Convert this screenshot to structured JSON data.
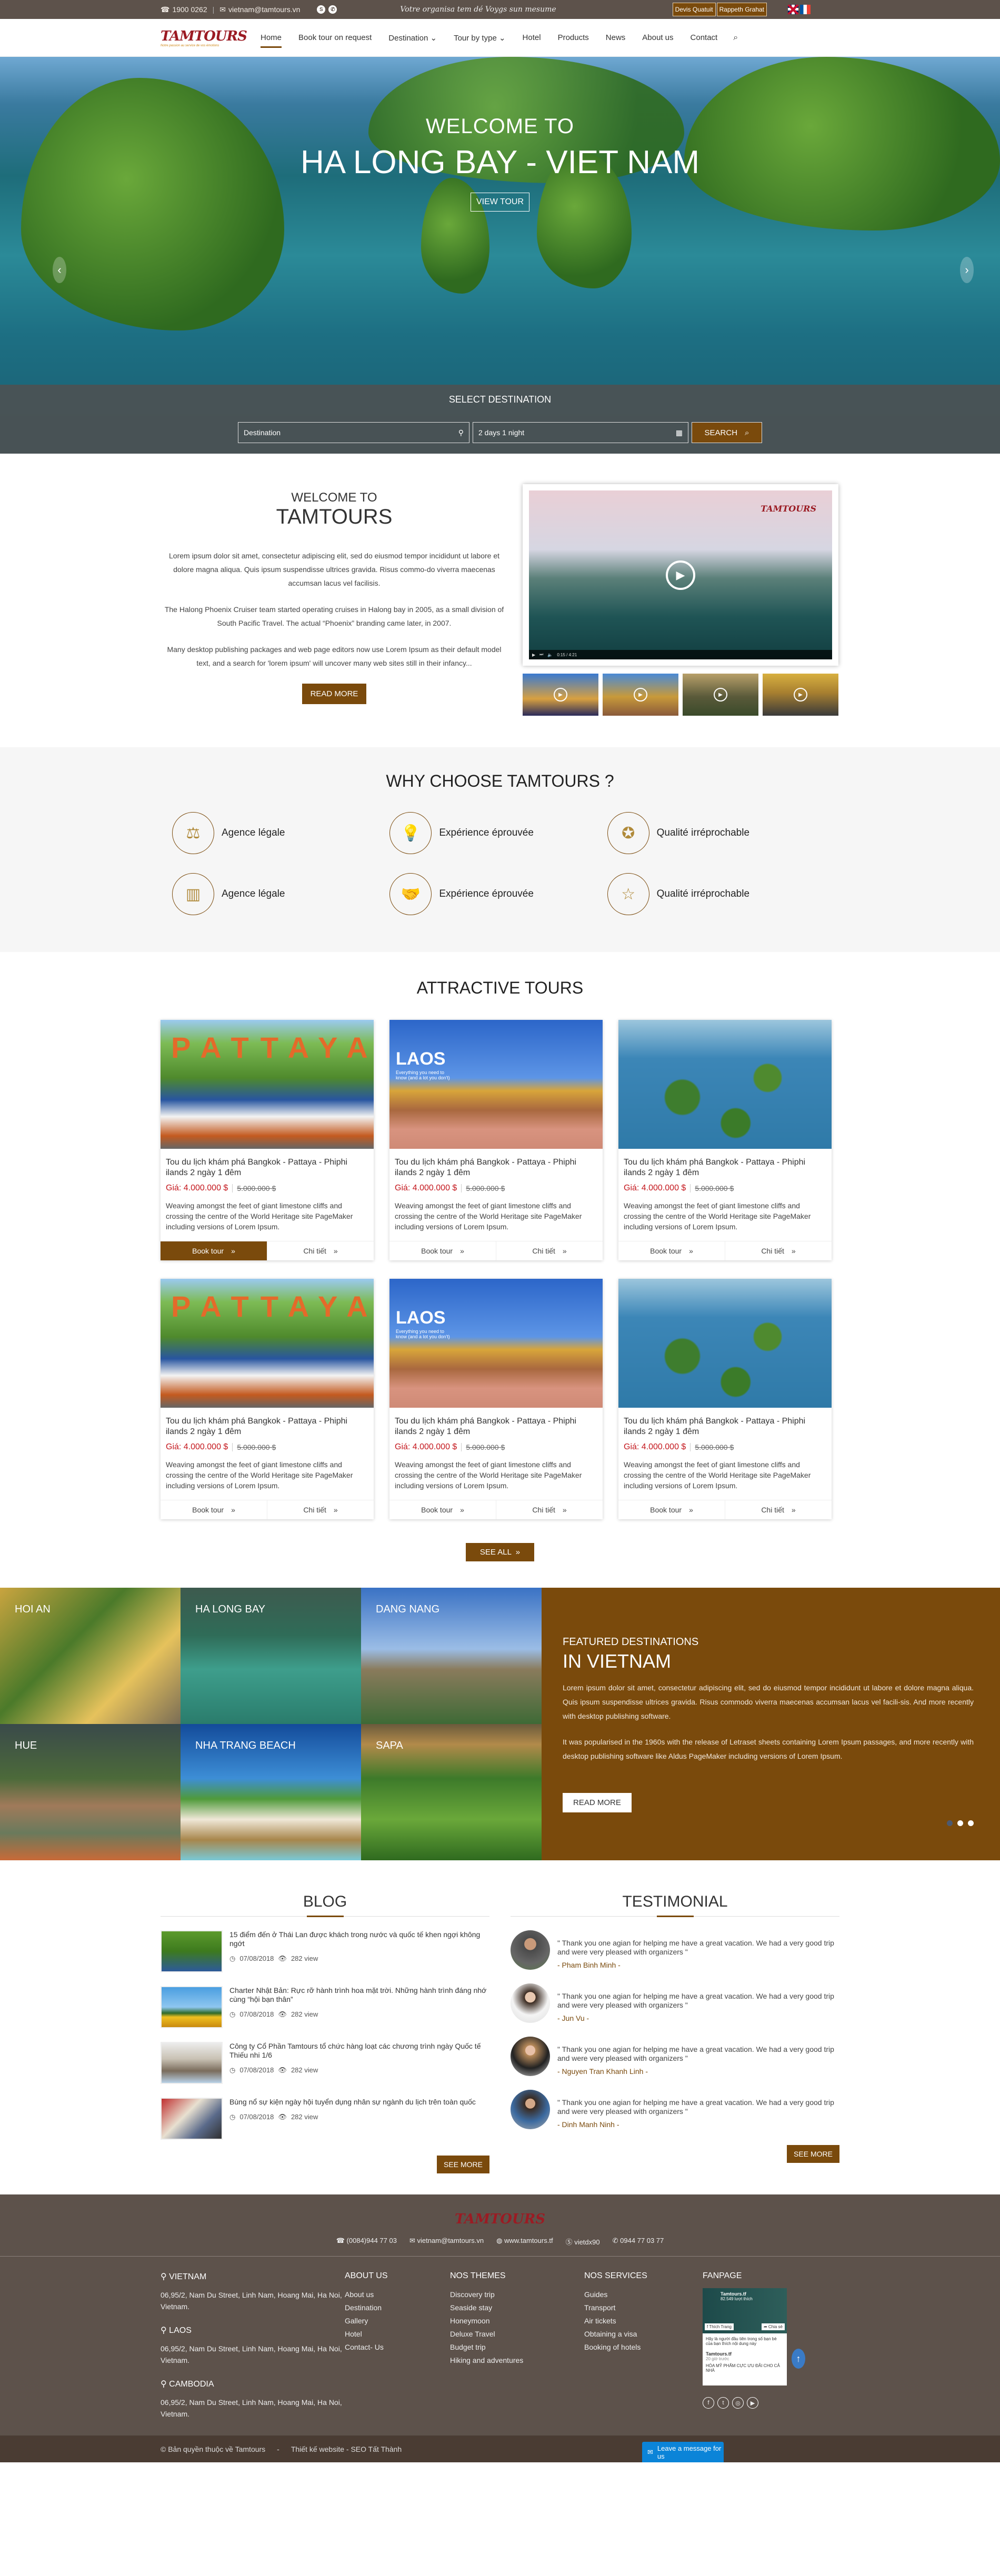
{
  "topbar": {
    "phone": "1900 0262",
    "email": "vietnam@tamtours.vn",
    "slogan": "Votre organisa tem dé Voygs sun mesume",
    "buttons": [
      "Devis Quatuit",
      "Rappeth Grahat"
    ],
    "languages": [
      "English",
      "Français"
    ]
  },
  "nav": {
    "logo_text": "TAMTOURS",
    "logo_tagline": "Notre passion au service de vos émotions",
    "items": [
      {
        "label": "Home",
        "active": true
      },
      {
        "label": "Book tour on request"
      },
      {
        "label": "Destination",
        "dropdown": true
      },
      {
        "label": "Tour by type",
        "dropdown": true
      },
      {
        "label": "Hotel"
      },
      {
        "label": "Products"
      },
      {
        "label": "News"
      },
      {
        "label": "About us"
      },
      {
        "label": "Contact"
      }
    ]
  },
  "hero": {
    "subtitle": "WELCOME TO",
    "title": "HA LONG BAY - VIET NAM",
    "button": "VIEW TOUR",
    "search": {
      "title": "SELECT DESTINATION",
      "destination_placeholder": "Destination",
      "duration_value": "2 days 1 night",
      "button": "SEARCH"
    }
  },
  "welcome": {
    "subtitle": "WELCOME TO",
    "title": "TAMTOURS",
    "paragraphs": [
      "Lorem ipsum dolor sit amet, consectetur adipiscing elit, sed do eiusmod tempor incididunt ut labore et dolore magna aliqua. Quis ipsum suspendisse ultrices gravida. Risus commo-do viverra maecenas accumsan lacus vel facilisis.",
      "The Halong Phoenix Cruiser team started operating cruises in Halong bay in 2005, as a small division of South Pacific Travel. The actual “Phoenix” branding came later, in 2007.",
      "Many desktop publishing packages and web page editors now use Lorem Ipsum as their default model text, and a search for 'lorem ipsum' will uncover many web sites still in their infancy..."
    ],
    "button": "READ MORE",
    "video": {
      "time": "0:15 / 4:21",
      "logo": "TAMTOURS"
    }
  },
  "why": {
    "title": "WHY CHOOSE TAMTOURS ?",
    "items": [
      {
        "label": "Agence légale",
        "icon": "gavel-icon"
      },
      {
        "label": "Expérience éprouvée",
        "icon": "lightbulb-brain-icon"
      },
      {
        "label": "Qualité irréprochable",
        "icon": "award-badge-icon"
      },
      {
        "label": "Agence légale",
        "icon": "building-check-icon"
      },
      {
        "label": "Expérience éprouvée",
        "icon": "handshake-icon"
      },
      {
        "label": "Qualité irréprochable",
        "icon": "star-icon"
      }
    ]
  },
  "tours": {
    "title": "ATTRACTIVE TOURS",
    "items": [
      {
        "image": "pattaya",
        "title": "Tou du lịch khám phá Bangkok - Pattaya - Phiphi ilands 2 ngày 1 đêm",
        "price": "Giá: 4.000.000 $",
        "old_price": "5.000.000 $",
        "desc": "Weaving amongst the feet of giant limestone cliffs and crossing the centre of the World Heritage site PageMaker including versions of Lorem Ipsum.",
        "book_active": true
      },
      {
        "image": "laos",
        "title": "Tou du lịch khám phá Bangkok - Pattaya - Phiphi ilands 2 ngày 1 đêm",
        "price": "Giá: 4.000.000 $",
        "old_price": "5.000.000 $",
        "desc": "Weaving amongst the feet of giant limestone cliffs and crossing the centre of the World Heritage site PageMaker including versions of Lorem Ipsum."
      },
      {
        "image": "halong",
        "title": "Tou du lịch khám phá Bangkok - Pattaya - Phiphi ilands 2 ngày 1 đêm",
        "price": "Giá: 4.000.000 $",
        "old_price": "5.000.000 $",
        "desc": "Weaving amongst the feet of giant limestone cliffs and crossing the centre of the World Heritage site PageMaker including versions of Lorem Ipsum."
      },
      {
        "image": "pattaya",
        "title": "Tou du lịch khám phá Bangkok - Pattaya - Phiphi ilands 2 ngày 1 đêm",
        "price": "Giá: 4.000.000 $",
        "old_price": "5.000.000 $",
        "desc": "Weaving amongst the feet of giant limestone cliffs and crossing the centre of the World Heritage site PageMaker including versions of Lorem Ipsum."
      },
      {
        "image": "laos",
        "title": "Tou du lịch khám phá Bangkok - Pattaya - Phiphi ilands 2 ngày 1 đêm",
        "price": "Giá: 4.000.000 $",
        "old_price": "5.000.000 $",
        "desc": "Weaving amongst the feet of giant limestone cliffs and crossing the centre of the World Heritage site PageMaker including versions of Lorem Ipsum."
      },
      {
        "image": "halong",
        "title": "Tou du lịch khám phá Bangkok - Pattaya - Phiphi ilands 2 ngày 1 đêm",
        "price": "Giá: 4.000.000 $",
        "old_price": "5.000.000 $",
        "desc": "Weaving amongst the feet of giant limestone cliffs and crossing the centre of the World Heritage site PageMaker including versions of Lorem Ipsum."
      }
    ],
    "book_label": "Book tour",
    "detail_label": "Chi tiết",
    "image_texts": {
      "pattaya": "PATTAYA",
      "laos": "LAOS",
      "laos_sub": "Everything you need to know (and a lot you don't)"
    },
    "see_all": "SEE ALL"
  },
  "featured": {
    "destinations": [
      "HOI AN",
      "HA LONG BAY",
      "DANG NANG",
      "HUE",
      "NHA TRANG BEACH",
      "SAPA"
    ],
    "subtitle": "FEATURED DESTINATIONS",
    "title": "IN VIETNAM",
    "paragraphs": [
      "Lorem ipsum dolor sit amet, consectetur adipiscing elit, sed do eiusmod tempor incididunt ut labore et dolore magna aliqua. Quis ipsum suspendisse ultrices gravida. Risus commodo viverra maecenas accumsan lacus vel facili-sis.  And more recently with desktop publishing software.",
      "It was popularised in the 1960s with the release of Letraset sheets containing Lorem Ipsum passages, and more recently with desktop publishing software like Aldus PageMaker including versions of Lorem Ipsum."
    ],
    "button": "READ MORE",
    "slide_count": 3,
    "active_slide": 1
  },
  "blog": {
    "title": "BLOG",
    "items": [
      {
        "title": "15 điểm đến ở Thái Lan được khách trong nước và quốc tế khen ngợi không ngớt",
        "date": "07/08/2018",
        "views": "282 view"
      },
      {
        "title": "Charter Nhật Bản: Rực rỡ hành trình hoa mặt trời. Những hành trình đáng nhớ cùng “hội bạn thân”",
        "date": "07/08/2018",
        "views": "282 view"
      },
      {
        "title": "Công ty Cổ Phần Tamtours tổ chức hàng loạt các chương trình ngày Quốc tế Thiếu nhi 1/6",
        "date": "07/08/2018",
        "views": "282 view"
      },
      {
        "title": "Bùng nổ sự kiện ngày hội tuyển dụng nhân sự ngành du lịch trên toàn quốc",
        "date": "07/08/2018",
        "views": "282 view"
      }
    ],
    "button": "SEE MORE"
  },
  "testimonial": {
    "title": "TESTIMONIAL",
    "items": [
      {
        "quote": "\" Thank you one agian for helping me have a great vacation. We had a very good trip and were very pleased with organizers \"",
        "name": "- Pham Binh Minh -"
      },
      {
        "quote": "\" Thank you one agian for helping me have a great vacation. We had a very good trip and were very pleased with organizers \"",
        "name": "- Jun Vu -"
      },
      {
        "quote": "\" Thank you one agian for helping me have a great vacation. We had a very good trip and were very pleased with organizers \"",
        "name": "- Nguyen Tran Khanh Linh -"
      },
      {
        "quote": "\" Thank you one agian for helping me have a great vacation. We had a very good trip and were very pleased with organizers \"",
        "name": "- Dinh Manh Ninh -"
      }
    ],
    "button": "SEE MORE"
  },
  "footer": {
    "logo_text": "TAMTOURS",
    "contacts": {
      "phone": "(0084)944 77 03",
      "email": "vietnam@tamtours.vn",
      "website": "www.tamtours.tf",
      "skype": "vietdx90",
      "whatsapp": "0944 77 03 77"
    },
    "offices": [
      {
        "country": "VIETNAM",
        "address": "06,95/2, Nam Du Street, Linh Nam, Hoang Mai, Ha Noi, Vietnam."
      },
      {
        "country": "LAOS",
        "address": "06,95/2, Nam Du Street, Linh Nam, Hoang Mai, Ha Noi, Vietnam."
      },
      {
        "country": "CAMBODIA",
        "address": "06,95/2, Nam Du Street, Linh Nam, Hoang Mai, Ha Noi, Vietnam."
      }
    ],
    "about": {
      "title": "ABOUT US",
      "links": [
        "About us",
        "Destination",
        "Gallery",
        "Hotel",
        "Contact- Us"
      ]
    },
    "themes": {
      "title": "NOS THEMES",
      "links": [
        "Discovery trip",
        "Seaside stay",
        "Honeymoon",
        "Deluxe Travel",
        "Budget trip",
        "Hiking and adventures"
      ]
    },
    "services": {
      "title": "NOS SERVICES",
      "links": [
        "Guides",
        "Transport",
        "Air tickets",
        "Obtaining a visa",
        "Booking of hotels"
      ]
    },
    "fanpage": {
      "title": "FANPAGE",
      "page_name": "Tamtours.tf",
      "likes": "82.549 lượt thích",
      "like_btn": "Thích Trang",
      "share_btn": "Chia sẻ",
      "notice": "Hãy là người đầu tiên trong số bạn bè của bạn thích nội dung này",
      "post_time": "20 giờ trước",
      "post_text": "HÓA MỸ PHẨM CỰC ƯU ĐÃI CHO CẢ NHÀ"
    },
    "copyright": "© Bản quyền thuộc về Tamtours",
    "separator": "-",
    "credit": "Thiết kế  website - SEO Tất Thành",
    "message_btn": "Leave a message for us"
  }
}
